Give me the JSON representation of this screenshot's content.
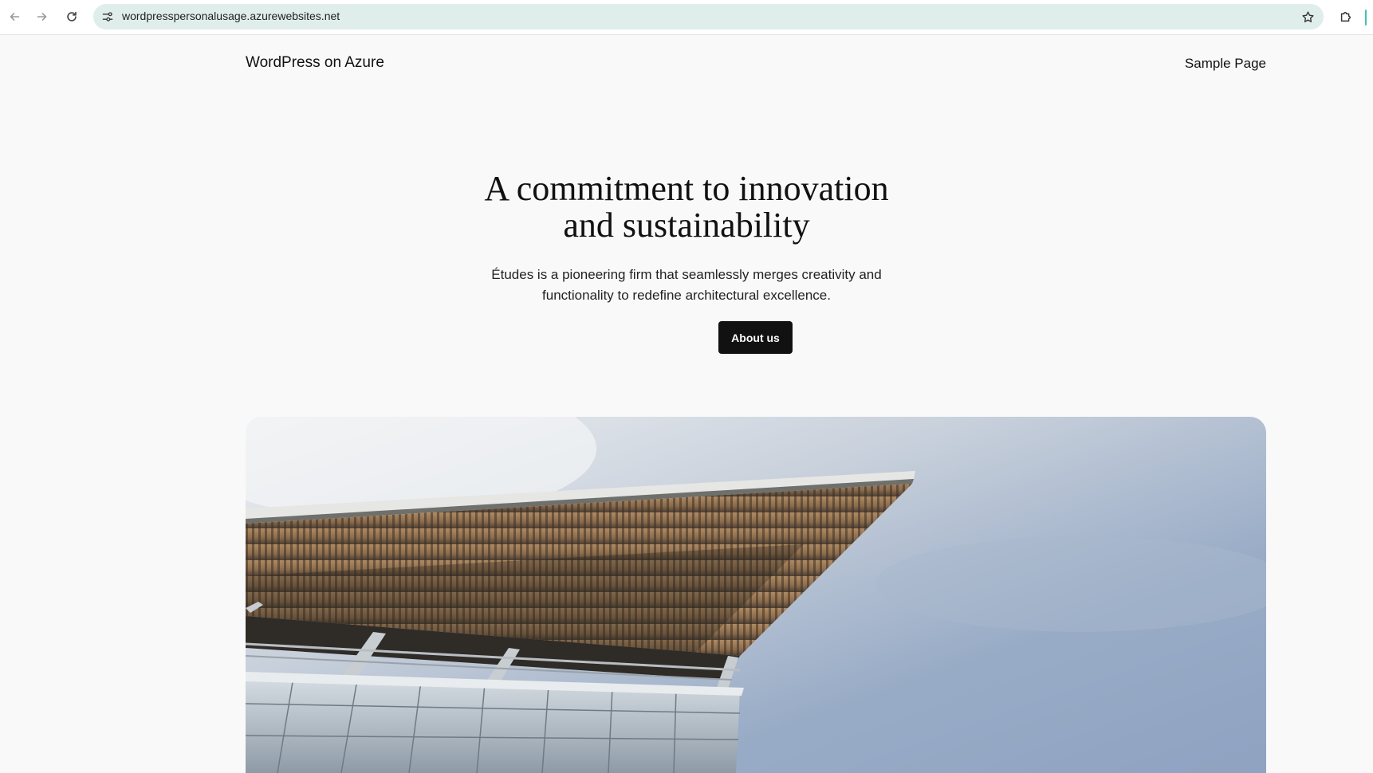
{
  "browser": {
    "url": "wordpresspersonalusage.azurewebsites.net",
    "icons": [
      "back-icon",
      "forward-icon",
      "reload-icon",
      "site-info-icon",
      "star-icon",
      "extensions-icon"
    ],
    "omnibox_color": "#dfeeea"
  },
  "site": {
    "title": "WordPress on Azure",
    "nav": [
      "Sample Page"
    ]
  },
  "hero": {
    "heading_line1": "A commitment to innovation",
    "heading_line2": "and sustainability",
    "text_line1": "Études is a pioneering firm that seamlessly merges creativity and",
    "text_line2": "functionality to redefine architectural excellence.",
    "button_label": "About us",
    "button_color": "#111111"
  }
}
